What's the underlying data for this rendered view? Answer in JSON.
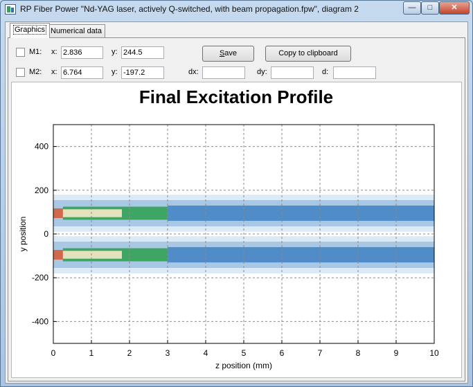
{
  "window": {
    "title": "RP Fiber Power \"Nd-YAG laser, actively Q-switched, with beam propagation.fpw\", diagram 2",
    "min_glyph": "—",
    "max_glyph": "□",
    "close_glyph": "✕"
  },
  "tabs": [
    {
      "label": "Graphics",
      "active": true
    },
    {
      "label": "Numerical data",
      "active": false
    }
  ],
  "markers": {
    "m1": {
      "label": "M1:",
      "x_label": "x:",
      "x_value": "2.836",
      "y_label": "y:",
      "y_value": "244.5",
      "checked": false
    },
    "m2": {
      "label": "M2:",
      "x_label": "x:",
      "x_value": "6.764",
      "y_label": "y:",
      "y_value": "-197.2",
      "checked": false
    }
  },
  "buttons": {
    "save_label": "ave",
    "save_mnemonic": "S",
    "copy_label": "Copy to clipboard"
  },
  "diff": {
    "dx_label": "dx:",
    "dx_value": "",
    "dy_label": "dy:",
    "dy_value": "",
    "d_label": "d:",
    "d_value": ""
  },
  "chart_data": {
    "type": "heatmap",
    "title": "Final Excitation Profile",
    "xlabel": "z position (mm)",
    "ylabel": "y position",
    "xlim": [
      0,
      10
    ],
    "ylim": [
      -500,
      500
    ],
    "x_ticks": [
      "0",
      "1",
      "2",
      "3",
      "4",
      "5",
      "6",
      "7",
      "8",
      "9",
      "10"
    ],
    "y_ticks": [
      "400",
      "200",
      "0",
      "-200",
      "-400"
    ],
    "y_tick_values": [
      400,
      200,
      0,
      -200,
      -400
    ],
    "grid": true,
    "grid_style": "dashed",
    "lobes_y_center": [
      95,
      -95
    ],
    "description_colors": {
      "peak": "#d2684a",
      "very_high": "#e4e2bd",
      "high": "#3ea564",
      "medium": "#4f8cc8",
      "low": "#a9c8e6",
      "very_low": "#dceaf6"
    },
    "bands": [
      {
        "z_start": 0.0,
        "z_end": 0.25,
        "level": "peak",
        "half_width": 22
      },
      {
        "z_start": 0.25,
        "z_end": 1.8,
        "level": "very_high",
        "half_width": 18
      },
      {
        "z_start": 0.25,
        "z_end": 3.0,
        "level": "high",
        "half_width": 30
      },
      {
        "z_start": 3.0,
        "z_end": 10.0,
        "level": "medium",
        "half_width": 35
      },
      {
        "z_start": 0.0,
        "z_end": 10.0,
        "level": "low",
        "half_width": 60
      },
      {
        "z_start": 0.0,
        "z_end": 10.0,
        "level": "very_low",
        "half_width": 85
      }
    ]
  }
}
